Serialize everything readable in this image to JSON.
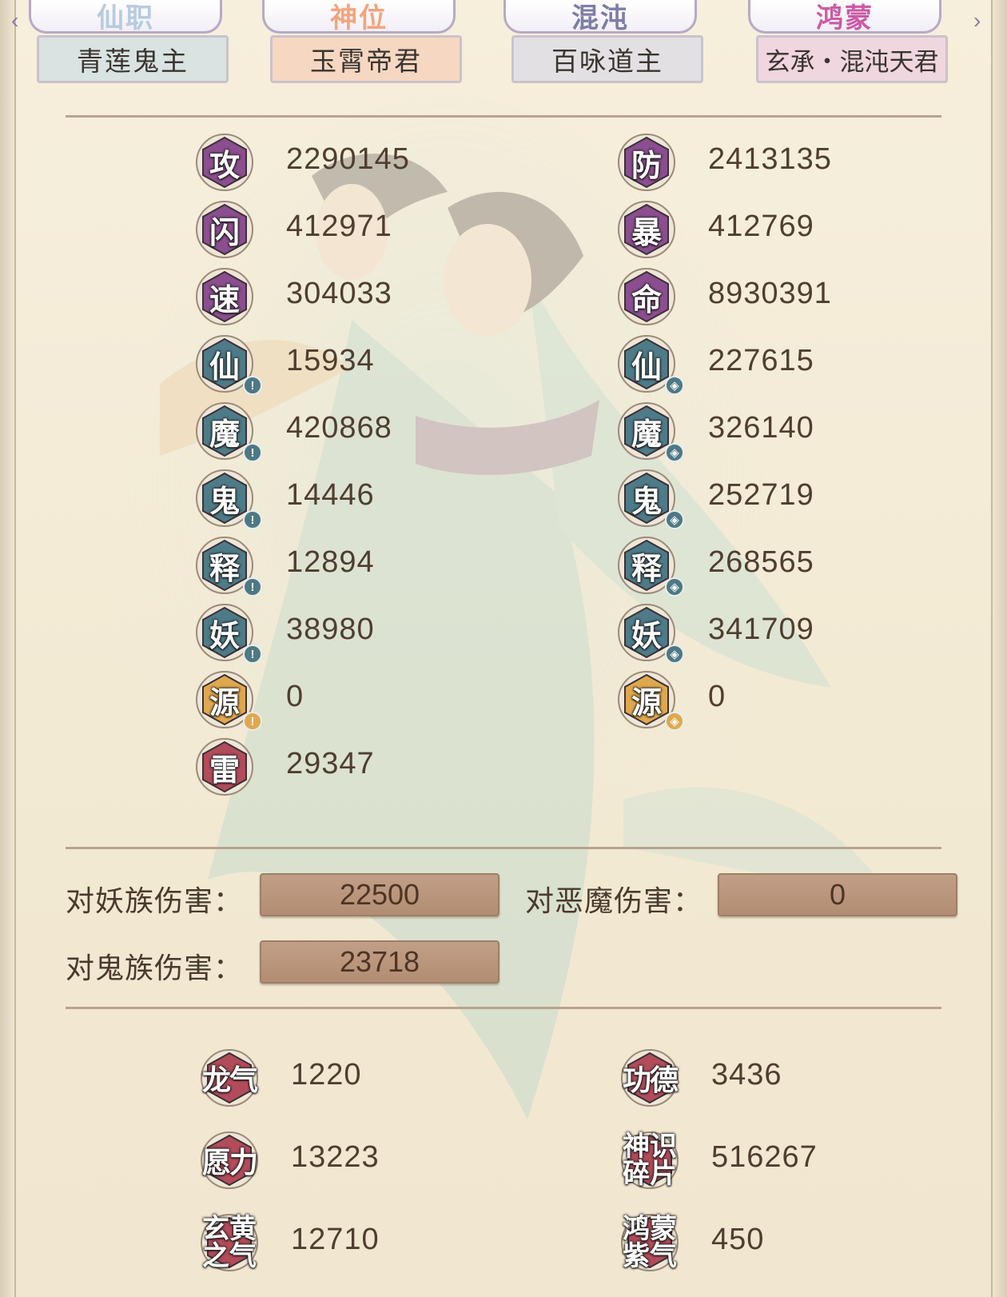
{
  "colors": {
    "background": "#f4ecd8",
    "divider": "#b9a38e",
    "badge_purple": "#8b4e8f",
    "badge_teal": "#4e7b88",
    "badge_gold": "#e0a84e",
    "badge_red": "#b24c5a",
    "damage_box": "#b9977e"
  },
  "tabs": [
    {
      "header": "仙职",
      "title": "青莲鬼主",
      "header_color": "#b6cbe0",
      "body_color": "#d9e3e2"
    },
    {
      "header": "神位",
      "title": "玉霄帝君",
      "header_color": "#f4a47e",
      "body_color": "#f6d7c2"
    },
    {
      "header": "混沌",
      "title": "百咏道主",
      "header_color": "#7d7ea7",
      "body_color": "#e3e0e3"
    },
    {
      "header": "鸿蒙",
      "title": "玄承・混沌天君",
      "header_color": "#cc5aa6",
      "body_color": "#efd6df"
    }
  ],
  "stats_left": [
    {
      "label": "攻",
      "value": "2290145",
      "badge": "badge_purple",
      "mini": ""
    },
    {
      "label": "闪",
      "value": "412971",
      "badge": "badge_purple",
      "mini": ""
    },
    {
      "label": "速",
      "value": "304033",
      "badge": "badge_purple",
      "mini": ""
    },
    {
      "label": "仙",
      "value": "15934",
      "badge": "badge_teal",
      "mini": "attack"
    },
    {
      "label": "魔",
      "value": "420868",
      "badge": "badge_teal",
      "mini": "attack"
    },
    {
      "label": "鬼",
      "value": "14446",
      "badge": "badge_teal",
      "mini": "attack"
    },
    {
      "label": "释",
      "value": "12894",
      "badge": "badge_teal",
      "mini": "attack"
    },
    {
      "label": "妖",
      "value": "38980",
      "badge": "badge_teal",
      "mini": "attack"
    },
    {
      "label": "源",
      "value": "0",
      "badge": "badge_gold",
      "mini": "attack"
    },
    {
      "label": "雷",
      "value": "29347",
      "badge": "badge_red",
      "mini": ""
    }
  ],
  "stats_right": [
    {
      "label": "防",
      "value": "2413135",
      "badge": "badge_purple",
      "mini": ""
    },
    {
      "label": "暴",
      "value": "412769",
      "badge": "badge_purple",
      "mini": ""
    },
    {
      "label": "命",
      "value": "8930391",
      "badge": "badge_purple",
      "mini": ""
    },
    {
      "label": "仙",
      "value": "227615",
      "badge": "badge_teal",
      "mini": "defense"
    },
    {
      "label": "魔",
      "value": "326140",
      "badge": "badge_teal",
      "mini": "defense"
    },
    {
      "label": "鬼",
      "value": "252719",
      "badge": "badge_teal",
      "mini": "defense"
    },
    {
      "label": "释",
      "value": "268565",
      "badge": "badge_teal",
      "mini": "defense"
    },
    {
      "label": "妖",
      "value": "341709",
      "badge": "badge_teal",
      "mini": "defense"
    },
    {
      "label": "源",
      "value": "0",
      "badge": "badge_gold",
      "mini": "defense"
    }
  ],
  "damage": {
    "yao_label": "对妖族伤害：",
    "yao_value": "22500",
    "demon_label": "对恶魔伤害：",
    "demon_value": "0",
    "ghost_label": "对鬼族伤害：",
    "ghost_value": "23718"
  },
  "resources_left": [
    {
      "label_lines": [
        "龙气"
      ],
      "value": "1220"
    },
    {
      "label_lines": [
        "愿力"
      ],
      "value": "13223"
    },
    {
      "label_lines": [
        "玄黄",
        "之气"
      ],
      "value": "12710"
    }
  ],
  "resources_right": [
    {
      "label_lines": [
        "功德"
      ],
      "value": "3436"
    },
    {
      "label_lines": [
        "神识",
        "碎片"
      ],
      "value": "516267"
    },
    {
      "label_lines": [
        "鸿蒙",
        "紫气"
      ],
      "value": "450"
    }
  ]
}
